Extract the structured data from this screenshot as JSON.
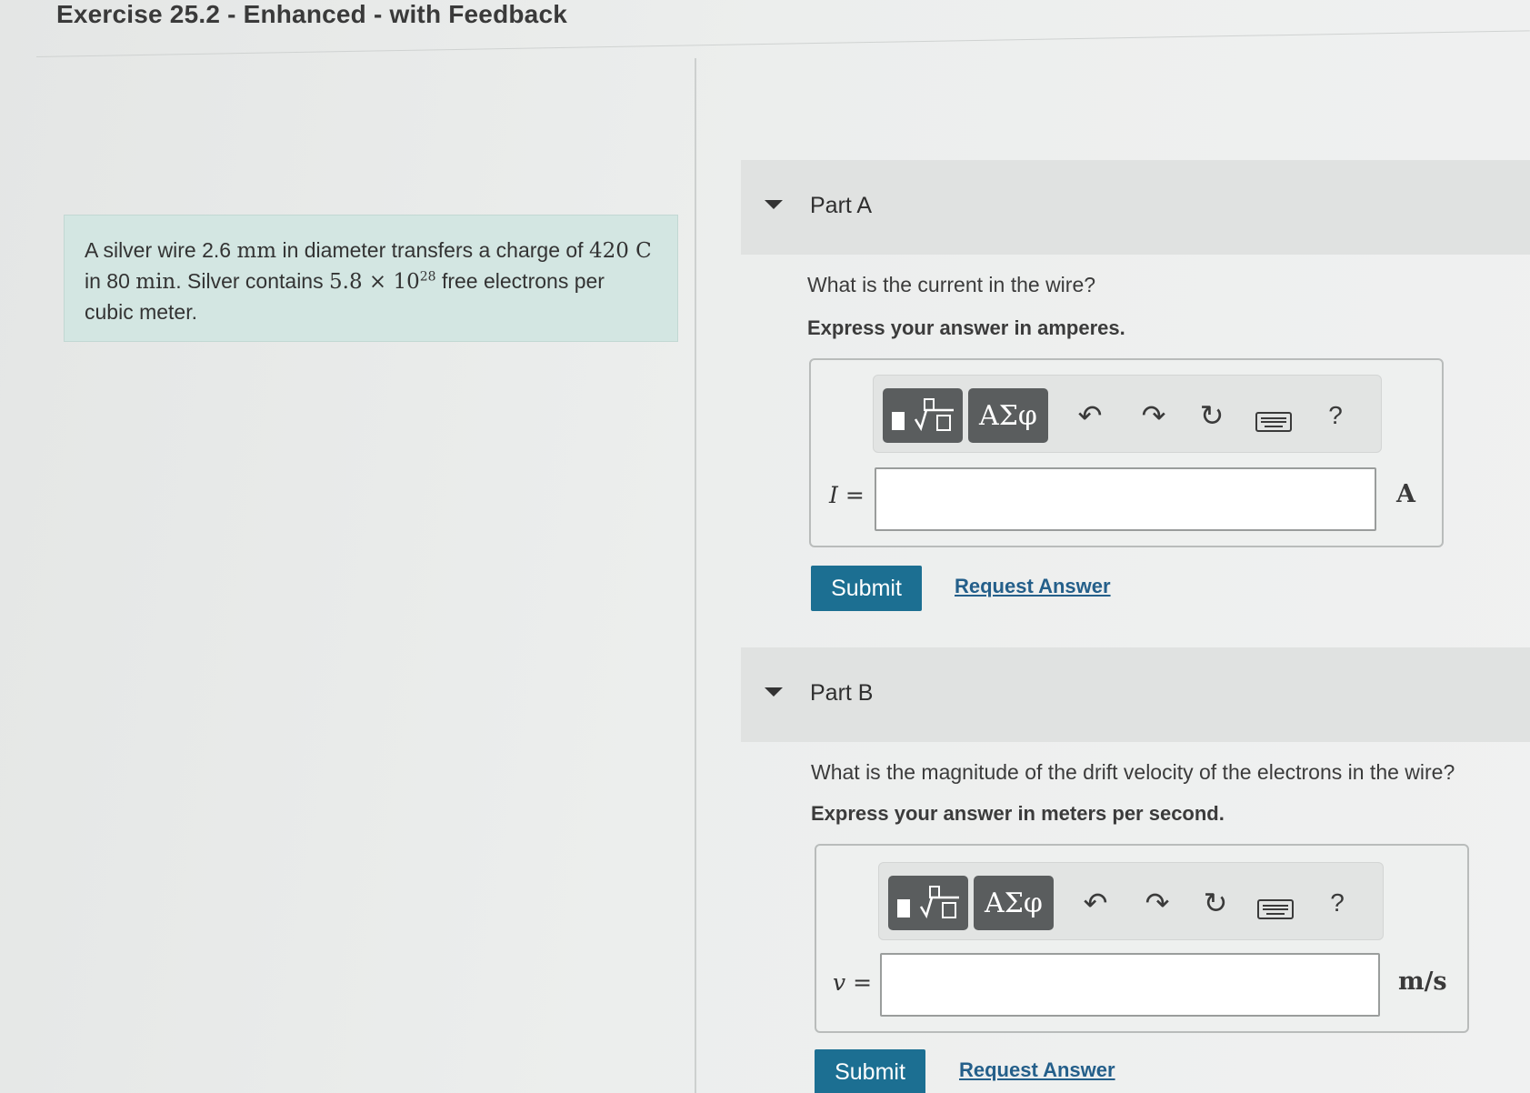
{
  "title": "Exercise 25.2 - Enhanced - with Feedback",
  "problem": {
    "p1": "A silver wire 2.6 ",
    "mm": "mm",
    "p2": " in diameter transfers a charge of ",
    "charge": "420 C",
    "p3": " in 80 ",
    "min": "min",
    "p4": ". Silver contains ",
    "n_base": "5.8 × 10",
    "n_exp": "28",
    "p5": " free electrons per cubic meter."
  },
  "parts": [
    {
      "label": "Part A",
      "question": "What is the current in the wire?",
      "instruction": "Express your answer in amperes.",
      "variable": "I =",
      "unit": "A",
      "submit": "Submit",
      "request": "Request Answer"
    },
    {
      "label": "Part B",
      "question": "What is the magnitude of the drift velocity of the electrons in the wire?",
      "instruction": "Express your answer in meters per second.",
      "variable": "v =",
      "unit": "m/s",
      "submit": "Submit",
      "request": "Request Answer"
    }
  ],
  "toolbar": {
    "greek": "ΑΣφ",
    "help": "?",
    "icons": [
      "templates-icon",
      "greek-icon",
      "undo-icon",
      "redo-icon",
      "reset-icon",
      "keyboard-icon",
      "help-icon"
    ]
  }
}
